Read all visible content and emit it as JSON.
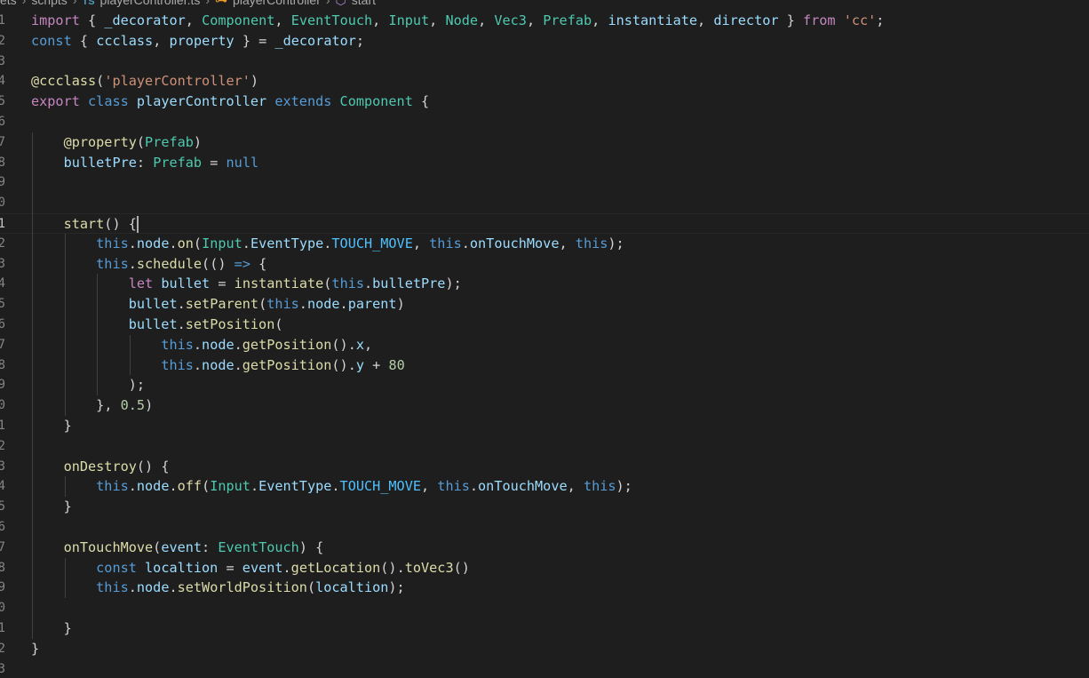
{
  "breadcrumb": {
    "folder_parent": "ets",
    "folder": "scripts",
    "file": "playerController.ts",
    "file_icon": "TS",
    "class": "playerController",
    "method": "start"
  },
  "editor": {
    "cursor_line": 11,
    "lines": [
      {
        "n": "1",
        "text": "import { _decorator, Component, EventTouch, Input, Node, Vec3, Prefab, instantiate, director } from 'cc';"
      },
      {
        "n": "2",
        "text": "const { ccclass, property } = _decorator;"
      },
      {
        "n": "3",
        "text": ""
      },
      {
        "n": "4",
        "text": "@ccclass('playerController')"
      },
      {
        "n": "5",
        "text": "export class playerController extends Component {"
      },
      {
        "n": "6",
        "text": ""
      },
      {
        "n": "7",
        "text": "    @property(Prefab)"
      },
      {
        "n": "8",
        "text": "    bulletPre: Prefab = null"
      },
      {
        "n": "9",
        "text": ""
      },
      {
        "n": "0",
        "text": ""
      },
      {
        "n": "1",
        "text": "    start() {"
      },
      {
        "n": "2",
        "text": "        this.node.on(Input.EventType.TOUCH_MOVE, this.onTouchMove, this);"
      },
      {
        "n": "3",
        "text": "        this.schedule(() => {"
      },
      {
        "n": "4",
        "text": "            let bullet = instantiate(this.bulletPre);"
      },
      {
        "n": "5",
        "text": "            bullet.setParent(this.node.parent)"
      },
      {
        "n": "6",
        "text": "            bullet.setPosition("
      },
      {
        "n": "7",
        "text": "                this.node.getPosition().x,"
      },
      {
        "n": "8",
        "text": "                this.node.getPosition().y + 80"
      },
      {
        "n": "9",
        "text": "            );"
      },
      {
        "n": "0",
        "text": "        }, 0.5)"
      },
      {
        "n": "1",
        "text": "    }"
      },
      {
        "n": "2",
        "text": ""
      },
      {
        "n": "3",
        "text": "    onDestroy() {"
      },
      {
        "n": "4",
        "text": "        this.node.off(Input.EventType.TOUCH_MOVE, this.onTouchMove, this);"
      },
      {
        "n": "5",
        "text": "    }"
      },
      {
        "n": "6",
        "text": ""
      },
      {
        "n": "7",
        "text": "    onTouchMove(event: EventTouch) {"
      },
      {
        "n": "8",
        "text": "        const localtion = event.getLocation().toVec3()"
      },
      {
        "n": "9",
        "text": "        this.node.setWorldPosition(localtion);"
      },
      {
        "n": "0",
        "text": ""
      },
      {
        "n": "1",
        "text": "    }"
      },
      {
        "n": "2",
        "text": "}"
      },
      {
        "n": "3",
        "text": ""
      }
    ]
  },
  "colors": {
    "background": "#1e1e1e",
    "keyword_control": "#c586c0",
    "keyword_storage": "#569cd6",
    "function": "#dcdcaa",
    "type": "#4ec9b0",
    "variable": "#9cdcfe",
    "constant": "#4fc1ff",
    "string": "#ce9178",
    "number": "#b5cea8",
    "line_number": "#858585"
  }
}
